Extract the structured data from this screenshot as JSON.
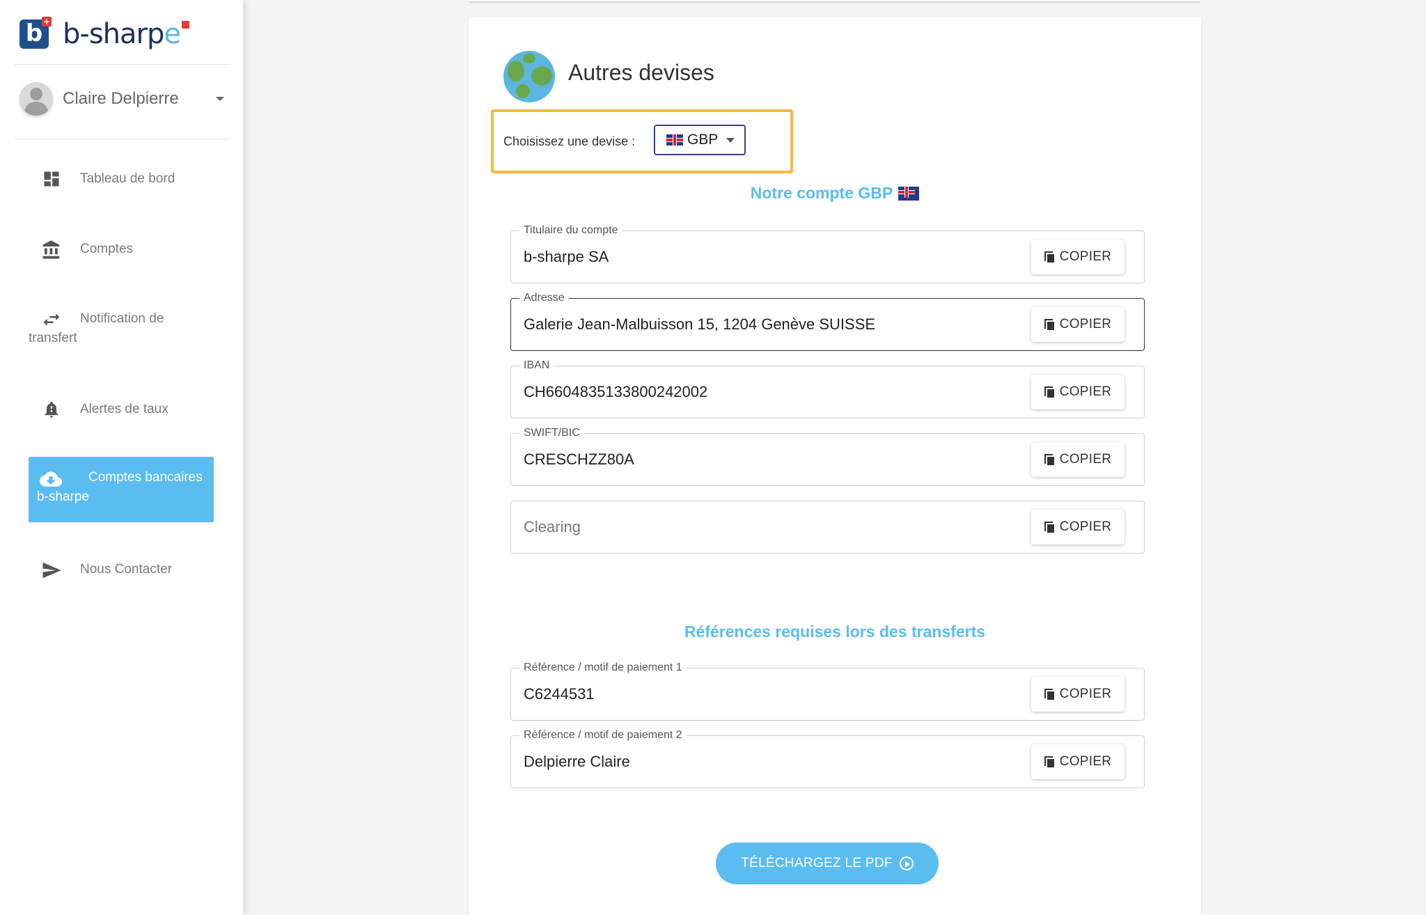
{
  "sidebar": {
    "logo": {
      "brand_prefix": "b-sharp",
      "brand_suffix": "e"
    },
    "user": {
      "name": "Claire Delpierre"
    },
    "items": [
      {
        "label": "Tableau de bord",
        "icon": "dashboard-icon"
      },
      {
        "label": "Comptes",
        "icon": "bank-icon"
      },
      {
        "label": "Notification de transfert",
        "icon": "transfer-arrows-icon"
      },
      {
        "label": "Alertes de taux",
        "icon": "bell-icon"
      },
      {
        "label": "Comptes bancaires b-sharpe",
        "icon": "cloud-download-icon",
        "active": true
      },
      {
        "label": "Nous Contacter",
        "icon": "send-icon"
      }
    ]
  },
  "main": {
    "title": "Autres devises",
    "currency_selector": {
      "label": "Choisissez une devise :",
      "value": "GBP"
    },
    "account_section_title": "Notre compte GBP",
    "account_fields": [
      {
        "label": "Titulaire du compte",
        "value": "b-sharpe SA"
      },
      {
        "label": "Adresse",
        "value": "Galerie Jean-Malbuisson 15, 1204 Genève SUISSE"
      },
      {
        "label": "IBAN",
        "value": "CH6604835133800242002"
      },
      {
        "label": "SWIFT/BIC",
        "value": "CRESCHZZ80A"
      },
      {
        "label": "",
        "placeholder": "Clearing"
      }
    ],
    "references_title": "Références requises lors des transferts",
    "reference_fields": [
      {
        "label": "Référence / motif de paiement 1",
        "value": "C6244531"
      },
      {
        "label": "Référence / motif de paiement 2",
        "value": "Delpierre Claire"
      }
    ],
    "copy_label": "COPIER",
    "pdf_button_label": "TÉLÉCHARGEZ LE PDF"
  },
  "colors": {
    "accent": "#5bbcf0",
    "highlight": "#f5b942",
    "brand_dark": "#1d2f5c"
  }
}
